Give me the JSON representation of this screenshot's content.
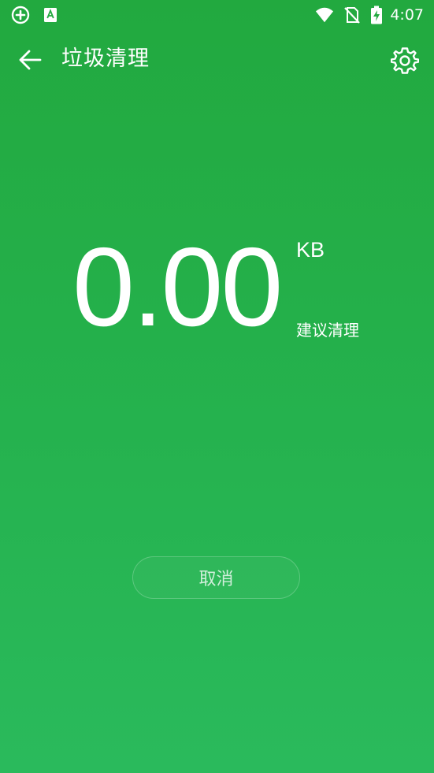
{
  "status_bar": {
    "time": "4:07",
    "icons": [
      "add-circle-icon",
      "a-square-icon",
      "wifi-icon",
      "no-sim-icon",
      "battery-charging-icon"
    ]
  },
  "toolbar": {
    "title": "垃圾清理",
    "back_icon": "arrow-back-icon",
    "settings_icon": "gear-icon"
  },
  "junk": {
    "size_value": "0.00",
    "size_unit": "KB",
    "note": "建议清理"
  },
  "actions": {
    "cancel_label": "取消"
  },
  "colors": {
    "background_top": "#22a93f",
    "background_bottom": "#2aba5c",
    "foreground": "#ffffff"
  }
}
